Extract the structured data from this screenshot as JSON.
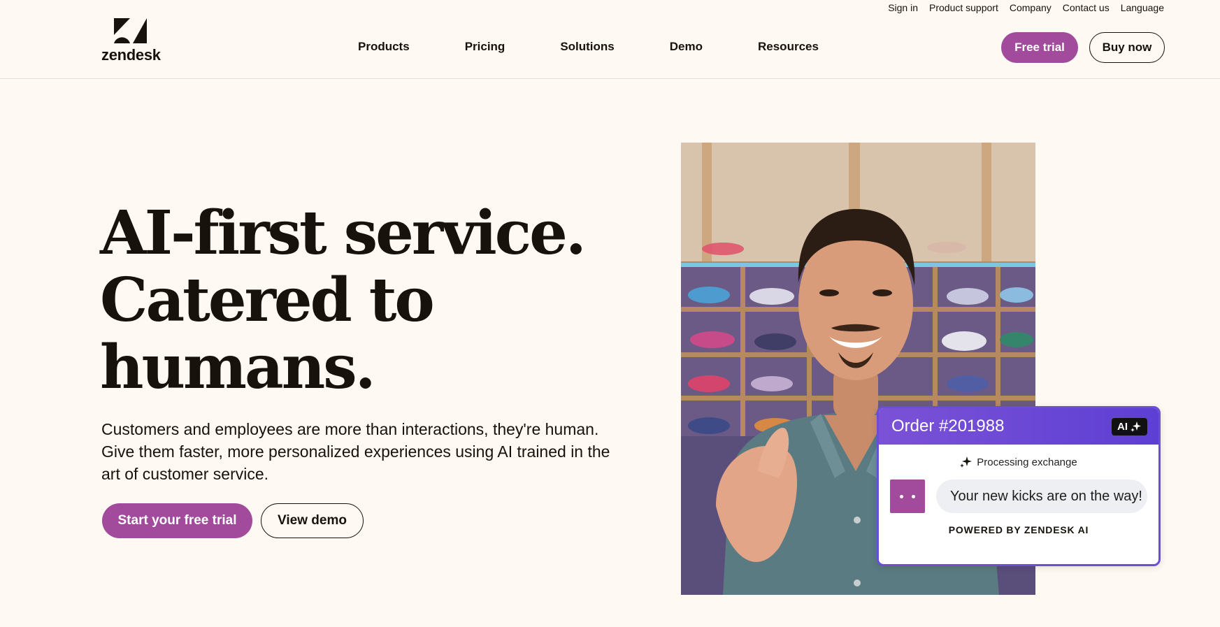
{
  "header": {
    "logo_text": "zendesk",
    "utility_links": [
      "Sign in",
      "Product support",
      "Company",
      "Contact us",
      "Language"
    ],
    "nav": [
      "Products",
      "Pricing",
      "Solutions",
      "Demo",
      "Resources"
    ],
    "free_trial_label": "Free trial",
    "buy_now_label": "Buy now"
  },
  "hero": {
    "title_lines": [
      "AI-first service.",
      "Catered to",
      "humans."
    ],
    "subtitle": "Customers and employees are more than interactions, they're human. Give them faster, more personalized experiences using AI trained in the art of customer service.",
    "primary_cta": "Start your free trial",
    "secondary_cta": "View demo"
  },
  "ai_card": {
    "title": "Order #201988",
    "badge": "AI",
    "status": "Processing exchange",
    "message": "Your new kicks are on the way!",
    "footer": "POWERED BY ZENDESK AI"
  },
  "colors": {
    "background": "#fff9f3",
    "brand_purple": "#a24a9c",
    "ai_header": "#6a4fd6",
    "text": "#17120c"
  },
  "icons": [
    "zendesk-logo-icon",
    "sparkle-icon",
    "ai-sparkle-icon"
  ]
}
